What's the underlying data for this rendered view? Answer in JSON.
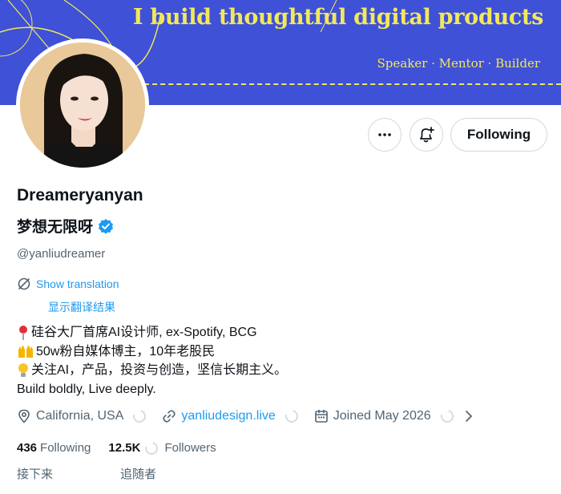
{
  "banner": {
    "title": "I build thoughtful digital products",
    "subtitle": "Speaker · Mentor · Builder",
    "bg_color": "#3f51d6",
    "accent_color": "#f2e85b"
  },
  "actions": {
    "more_icon": "more-horizontal-icon",
    "notify_icon": "bell-plus-icon",
    "follow_label": "Following"
  },
  "profile": {
    "display_name": "Dreameryanyan",
    "cn_name": "梦想无限呀",
    "verified_icon": "verified-badge-icon",
    "handle": "@yanliudreamer"
  },
  "translation": {
    "show_label": "Show translation",
    "show_label_cn": "显示翻译结果"
  },
  "bio": {
    "line1": "硅谷大厂首席AI设计师, ex-Spotify, BCG",
    "line2": " 50w粉自媒体博主，10年老股民",
    "line3": "关注AI，产品，投资与创造，坚信长期主义。",
    "line4": "Build boldly, Live deeply."
  },
  "meta": {
    "location": "California, USA",
    "website": "yanliudesign.live",
    "joined": "Joined May 2026"
  },
  "stats": {
    "following_count": "436",
    "following_label": "Following",
    "following_cn": "接下来",
    "followers_count": "12.5K",
    "followers_label": "Followers",
    "followers_cn": "追随者"
  },
  "colors": {
    "link_blue": "#1d9bf0",
    "muted_text": "#536471",
    "border": "#cfd9de"
  }
}
